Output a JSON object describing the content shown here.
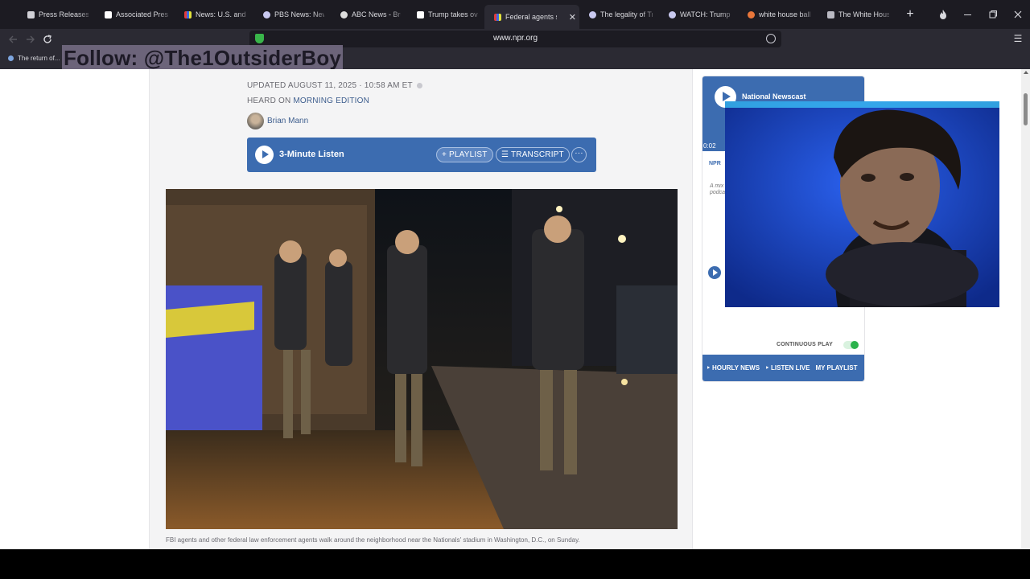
{
  "browser": {
    "tabs": [
      {
        "label": "Press Releases - D",
        "favicon": "page-icon"
      },
      {
        "label": "Associated Press &",
        "favicon": "ap-logo-icon"
      },
      {
        "label": "News: U.S. and Wo",
        "favicon": "news-icon"
      },
      {
        "label": "PBS News: News, A",
        "favicon": "pbs-icon"
      },
      {
        "label": "ABC News - Breaki",
        "favicon": "abc-icon"
      },
      {
        "label": "Trump takes over ",
        "favicon": "ap-logo-icon"
      },
      {
        "label": "Federal agents spre",
        "favicon": "npr-icon",
        "active": true
      },
      {
        "label": "The legality of Tru",
        "favicon": "pbs-icon"
      },
      {
        "label": "WATCH: Trump say",
        "favicon": "pbs-icon"
      },
      {
        "label": "white house ballro",
        "favicon": "search-icon"
      },
      {
        "label": "The White House",
        "favicon": "whitehouse-icon"
      }
    ],
    "url": "www.npr.org",
    "bookmark": "The return of...",
    "tab_close_glyph": "✕",
    "new_tab_glyph": "+"
  },
  "overlay_text": "Follow: @The1OutsiderBoy",
  "article": {
    "updated": "UPDATED AUGUST 11, 2025 · 10:58 AM ET",
    "heard_prefix": "HEARD ON",
    "heard_show": "MORNING EDITION",
    "author": "Brian Mann",
    "player": {
      "listen_label": "3-Minute Listen",
      "playlist_label": "+ PLAYLIST",
      "transcript_label": "☰ TRANSCRIPT",
      "more_label": "···"
    },
    "caption": "FBI agents and other federal law enforcement agents walk around the neighborhood near the Nationals' stadium in Washington, D.C., on Sunday.",
    "credit": ""
  },
  "npr_player": {
    "title": "National Newscast",
    "time": "0:02",
    "tab_label": "NPR",
    "description": "A mix of podcasts",
    "continuous_play": "CONTINUOUS PLAY",
    "links": [
      "‣ HOURLY NEWS",
      "‣ LISTEN LIVE",
      "MY PLAYLIST"
    ]
  },
  "colors": {
    "npr_blue": "#3c6cb0",
    "tab_bg": "#1c1b22",
    "toolbar_bg": "#2b2a33"
  }
}
